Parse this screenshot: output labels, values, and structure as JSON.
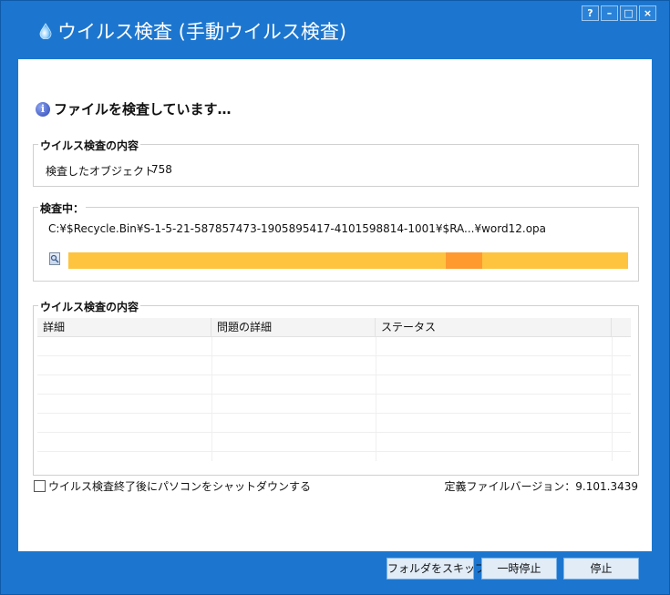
{
  "window": {
    "title": "ウイルス検査 (手動ウイルス検査)",
    "controls": [
      "?",
      "–",
      "□",
      "×"
    ]
  },
  "heading": "ファイルを検査しています…",
  "summary": {
    "legend": "ウイルス検査の内容",
    "objects_label": "検査したオブジェクト",
    "objects_value": "758"
  },
  "scanning": {
    "legend": "検査中：",
    "path": "C:¥$Recycle.Bin¥S-1-5-21-587857473-1905895417-4101598814-1001¥$RA...¥word12.opa",
    "progress_active_start": 0.675,
    "progress_active_end": 0.74
  },
  "results": {
    "legend": "ウイルス検査の内容",
    "columns": [
      "詳細",
      "問題の詳細",
      "ステータス",
      ""
    ],
    "rows": []
  },
  "shutdown_checkbox": {
    "label": "ウイルス検査終了後にパソコンをシャットダウンする",
    "checked": false
  },
  "version": "定義ファイルバージョン：9.101.3439",
  "buttons": {
    "skip": "フォルダをスキップ",
    "pause": "一時停止",
    "stop": "停止"
  },
  "colors": {
    "window_blue": "#1c76cf",
    "progress_base": "#fec43f",
    "progress_active": "#fe9a2e"
  },
  "icons": {
    "app": "droplet-icon",
    "heading": "info-icon",
    "scan": "document-magnifier-icon"
  }
}
